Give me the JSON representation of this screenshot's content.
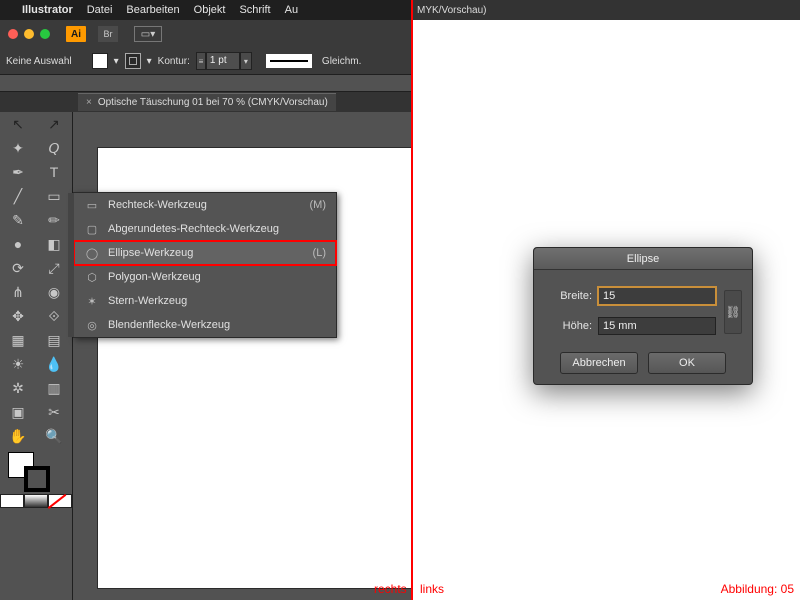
{
  "menubar": {
    "apple": "",
    "app": "Illustrator",
    "items": [
      "Datei",
      "Bearbeiten",
      "Objekt",
      "Schrift",
      "Au"
    ]
  },
  "winchrome": {
    "ai": "Ai",
    "br": "Br"
  },
  "controlbar": {
    "selection": "Keine Auswahl",
    "stroke_label": "Kontur:",
    "stroke_value": "1 pt",
    "linestyle": "Gleichm."
  },
  "doctab": {
    "label": "Optische Täuschung 01 bei 70 % (CMYK/Vorschau)"
  },
  "right_tab": {
    "label": "MYK/Vorschau)"
  },
  "flyout": {
    "items": [
      {
        "icon": "▭",
        "label": "Rechteck-Werkzeug",
        "shortcut": "(M)"
      },
      {
        "icon": "▢",
        "label": "Abgerundetes-Rechteck-Werkzeug",
        "shortcut": ""
      },
      {
        "icon": "◯",
        "label": "Ellipse-Werkzeug",
        "shortcut": "(L)"
      },
      {
        "icon": "⬡",
        "label": "Polygon-Werkzeug",
        "shortcut": ""
      },
      {
        "icon": "✶",
        "label": "Stern-Werkzeug",
        "shortcut": ""
      },
      {
        "icon": "◎",
        "label": "Blendenflecke-Werkzeug",
        "shortcut": ""
      }
    ],
    "selected_index": 2
  },
  "dialog": {
    "title": "Ellipse",
    "width_label": "Breite:",
    "height_label": "Höhe:",
    "width_value": "15",
    "height_value": "15 mm",
    "cancel": "Abbrechen",
    "ok": "OK",
    "link_icon": "⧉"
  },
  "labels": {
    "rechts": "rechts",
    "links": "links",
    "abb": "Abbildung: 05"
  },
  "icons": {
    "chevron": "▾",
    "step": "≡",
    "close": "×",
    "cursor": "↖",
    "dsel": "↗",
    "wand": "✦",
    "lasso": "𝘘",
    "pen": "✒",
    "type": "T",
    "line": "╱",
    "rect": "▭",
    "brush": "✎",
    "pencil": "✏",
    "blob": "●",
    "eraser": "◧",
    "rotate": "⟳",
    "scale": "⤢",
    "width": "⋔",
    "warp": "◉",
    "shapeb": "⟐",
    "free": "✥",
    "eyedrop": "💧",
    "mesh": "▦",
    "grad": "▤",
    "blend": "☀",
    "sym": "✲",
    "col": "▥",
    "artb": "▣",
    "slice": "✂",
    "hand": "✋",
    "zoom": "🔍",
    "link": "⛓"
  }
}
